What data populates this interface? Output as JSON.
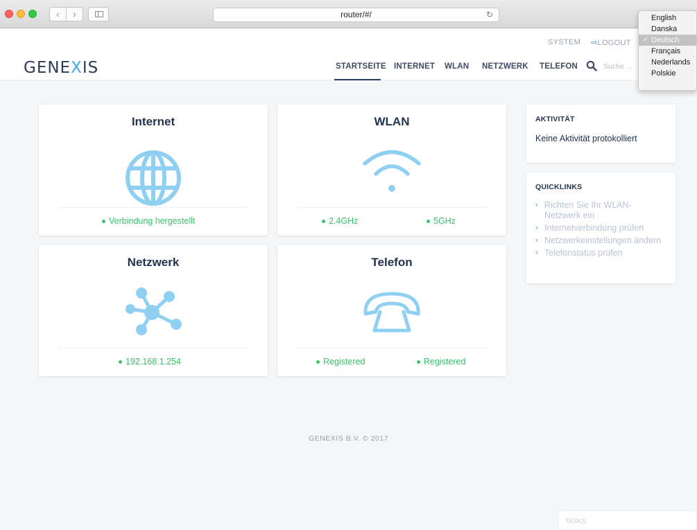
{
  "browser": {
    "url": "router/#/",
    "back_icon": "chevron-left-icon",
    "forward_icon": "chevron-right-icon",
    "reload_icon": "reload-icon"
  },
  "language_menu": {
    "items": [
      "English",
      "Danska",
      "Deutsch",
      "Français",
      "Nederlands",
      "Polskie"
    ],
    "selected": "Deutsch"
  },
  "header": {
    "logo_left": "GENE",
    "logo_x": "X",
    "logo_right": "IS",
    "system": "SYSTEM",
    "logout": "LOGOUT",
    "nav": [
      "STARTSEITE",
      "INTERNET",
      "WLAN",
      "NETZWERK",
      "TELEFON"
    ],
    "active_nav": "STARTSEITE",
    "search_placeholder": "Suche ..."
  },
  "cards": {
    "internet": {
      "title": "Internet",
      "status": "Verbindung hergestellt",
      "icon": "globe-icon"
    },
    "wlan": {
      "title": "WLAN",
      "status_24": "2.4GHz",
      "status_5": "5GHz",
      "icon": "wifi-icon"
    },
    "netzwerk": {
      "title": "Netzwerk",
      "status": "192.168.1.254",
      "icon": "network-icon"
    },
    "telefon": {
      "title": "Telefon",
      "status_1": "Registered",
      "status_2": "Registered",
      "icon": "telephone-icon"
    }
  },
  "activity": {
    "title": "AKTIVITÄT",
    "text": "Keine Aktivität protokolliert"
  },
  "quicklinks": {
    "title": "QUICKLINKS",
    "items": [
      "Richten Sie Ihr WLAN-Netzwerk ein",
      "Internetverbindung prüfen",
      "Netzwerkeinstellungen ändern",
      "Telefonstatus prüfen"
    ]
  },
  "footer": "GENEXIS B.V. © 2017",
  "tasks": "TASKS",
  "colors": {
    "accent_blue": "#4da6e8",
    "status_green": "#36c36a",
    "title_navy": "#22334f",
    "icon_blue": "#8fd0f2"
  }
}
